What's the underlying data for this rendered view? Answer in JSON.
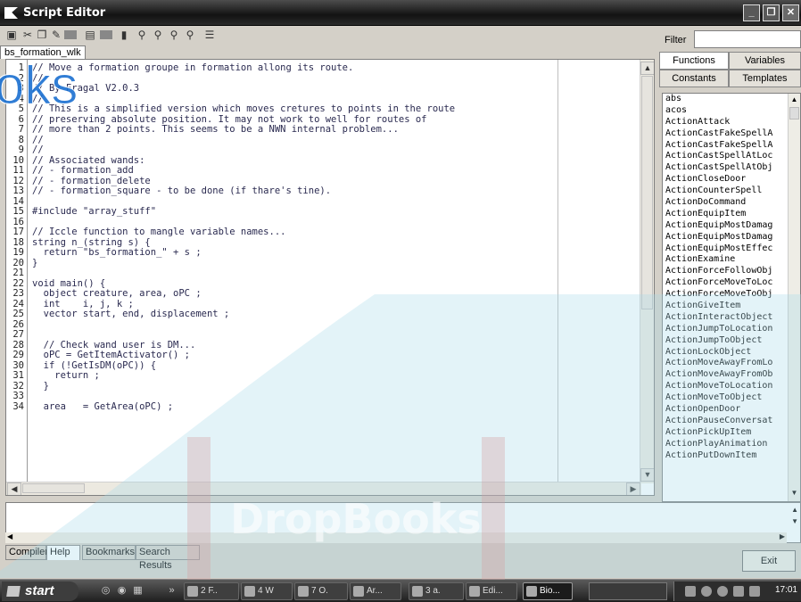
{
  "window": {
    "title": "Script Editor",
    "controls": {
      "minimize": "_",
      "restore": "❐",
      "close": "✕"
    }
  },
  "toolbar": {
    "icons": [
      "print-icon",
      "cut-icon",
      "copy-icon",
      "paste-icon",
      "square-icon",
      "save-icon",
      "square2-icon",
      "bookmark-icon",
      "find-icon",
      "find-next-icon",
      "replace-icon",
      "replace-all-icon",
      "list-icon"
    ]
  },
  "file_tab": {
    "label": "bs_formation_wlk"
  },
  "editor": {
    "lines": [
      {
        "n": "1",
        "t": "// Move a formation groupe in formation allong its route."
      },
      {
        "n": "2",
        "t": "//"
      },
      {
        "n": "3",
        "t": "// By Fragal V2.0.3"
      },
      {
        "n": "4",
        "t": "//"
      },
      {
        "n": "5",
        "t": "// This is a simplified version which moves cretures to points in the route"
      },
      {
        "n": "6",
        "t": "// preserving absolute position. It may not work to well for routes of"
      },
      {
        "n": "7",
        "t": "// more than 2 points. This seems to be a NWN internal problem..."
      },
      {
        "n": "8",
        "t": "//"
      },
      {
        "n": "9",
        "t": "//"
      },
      {
        "n": "10",
        "t": "// Associated wands:"
      },
      {
        "n": "11",
        "t": "// - formation_add"
      },
      {
        "n": "12",
        "t": "// - formation_delete"
      },
      {
        "n": "13",
        "t": "// - formation_square - to be done (if thare's tine)."
      },
      {
        "n": "14",
        "t": ""
      },
      {
        "n": "15",
        "t": "#include \"array_stuff\""
      },
      {
        "n": "16",
        "t": ""
      },
      {
        "n": "17",
        "t": "// Iccle function to mangle variable names..."
      },
      {
        "n": "18",
        "t": "string n_(string s) {"
      },
      {
        "n": "19",
        "t": "  return \"bs_formation_\" + s ;"
      },
      {
        "n": "20",
        "t": "}"
      },
      {
        "n": "21",
        "t": ""
      },
      {
        "n": "22",
        "t": "void main() {"
      },
      {
        "n": "23",
        "t": "  object creature, area, oPC ;"
      },
      {
        "n": "24",
        "t": "  int    i, j, k ;"
      },
      {
        "n": "25",
        "t": "  vector start, end, displacement ;"
      },
      {
        "n": "26",
        "t": ""
      },
      {
        "n": "27",
        "t": ""
      },
      {
        "n": "28",
        "t": "  // Check wand user is DM..."
      },
      {
        "n": "29",
        "t": "  oPC = GetItemActivator() ;"
      },
      {
        "n": "30",
        "t": "  if (!GetIsDM(oPC)) {"
      },
      {
        "n": "31",
        "t": "    return ;"
      },
      {
        "n": "32",
        "t": "  }"
      },
      {
        "n": "33",
        "t": ""
      },
      {
        "n": "34",
        "t": "  area   = GetArea(oPC) ;"
      }
    ]
  },
  "right_panel": {
    "filter_label": "Filter",
    "filter_value": "",
    "tabs": [
      "Functions",
      "Variables",
      "Constants",
      "Templates"
    ],
    "functions": [
      "abs",
      "acos",
      "ActionAttack",
      "ActionCastFakeSpellA",
      "ActionCastFakeSpellA",
      "ActionCastSpellAtLoc",
      "ActionCastSpellAtObj",
      "ActionCloseDoor",
      "ActionCounterSpell",
      "ActionDoCommand",
      "ActionEquipItem",
      "ActionEquipMostDamag",
      "ActionEquipMostDamag",
      "ActionEquipMostEffec",
      "ActionExamine",
      "ActionForceFollowObj",
      "ActionForceMoveToLoc",
      "ActionForceMoveToObj",
      "ActionGiveItem",
      "ActionInteractObject",
      "ActionJumpToLocation",
      "ActionJumpToObject",
      "ActionLockObject",
      "ActionMoveAwayFromLo",
      "ActionMoveAwayFromOb",
      "ActionMoveToLocation",
      "ActionMoveToObject",
      "ActionOpenDoor",
      "ActionPauseConversat",
      "ActionPickUpItem",
      "ActionPlayAnimation",
      "ActionPutDownItem"
    ]
  },
  "bottom_tabs": [
    "Compiler",
    "Help",
    "Bookmarks",
    "Search Results"
  ],
  "exit_label": "Exit",
  "taskbar": {
    "start_label": "start",
    "quick_more": "»",
    "items": [
      {
        "label": "2 F.."
      },
      {
        "label": "4 W"
      },
      {
        "label": "7 O."
      },
      {
        "label": "Ar..."
      },
      {
        "label": "3 a."
      },
      {
        "label": "Edi..."
      },
      {
        "label": "Bio..."
      }
    ],
    "clock": "17:01"
  },
  "watermark": {
    "text_top": "oks",
    "text_bottom": "DropBooks"
  }
}
